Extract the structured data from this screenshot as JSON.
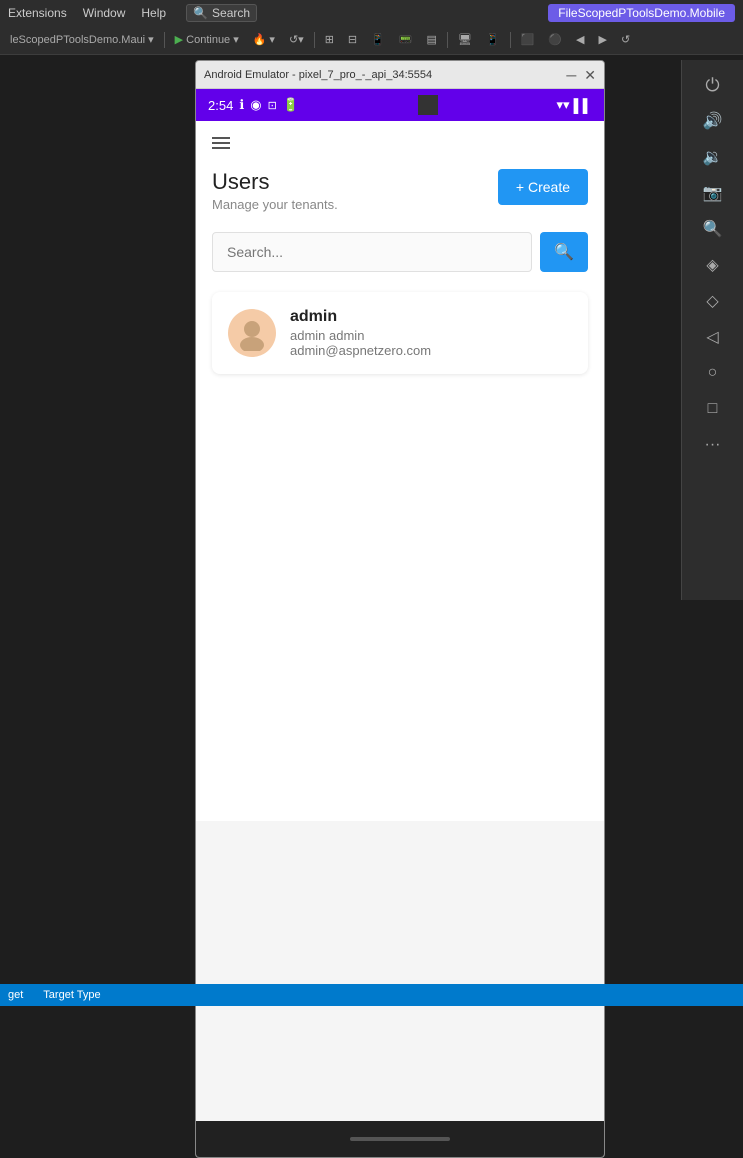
{
  "menubar": {
    "items": [
      "Extensions",
      "Window",
      "Help"
    ]
  },
  "search": {
    "label": "Search",
    "placeholder": "Search..."
  },
  "tabs": {
    "active": "FileScopedPToolsDemo.Mobile"
  },
  "toolbar": {
    "project_dropdown": "leScopedPToolsDemo.Maui",
    "continue_btn": "Continue",
    "arrows_left": "◀",
    "arrows_right": "▶"
  },
  "emulator": {
    "title": "Android Emulator - pixel_7_pro_-_api_34:5554",
    "status_time": "2:54",
    "screen": {
      "hamburger_label": "menu",
      "page_title": "Users",
      "page_subtitle": "Manage your tenants.",
      "create_btn": "+ Create",
      "search_placeholder": "Search...",
      "search_btn_icon": "🔍",
      "user": {
        "name": "admin",
        "fullname": "admin admin",
        "email": "admin@aspnetzero.com"
      }
    }
  },
  "right_panel": {
    "buttons": [
      {
        "icon": "⏻",
        "name": "power"
      },
      {
        "icon": "🔊",
        "name": "volume-up"
      },
      {
        "icon": "🔉",
        "name": "volume-down"
      },
      {
        "icon": "📷",
        "name": "camera"
      },
      {
        "icon": "🔍",
        "name": "zoom-in"
      },
      {
        "icon": "⬡",
        "name": "shape1"
      },
      {
        "icon": "◇",
        "name": "shape2"
      },
      {
        "icon": "◁",
        "name": "back"
      },
      {
        "icon": "○",
        "name": "home"
      },
      {
        "icon": "□",
        "name": "recents"
      },
      {
        "icon": "···",
        "name": "more"
      }
    ]
  },
  "bottom_status": {
    "items": [
      "get",
      "Target Type"
    ]
  }
}
